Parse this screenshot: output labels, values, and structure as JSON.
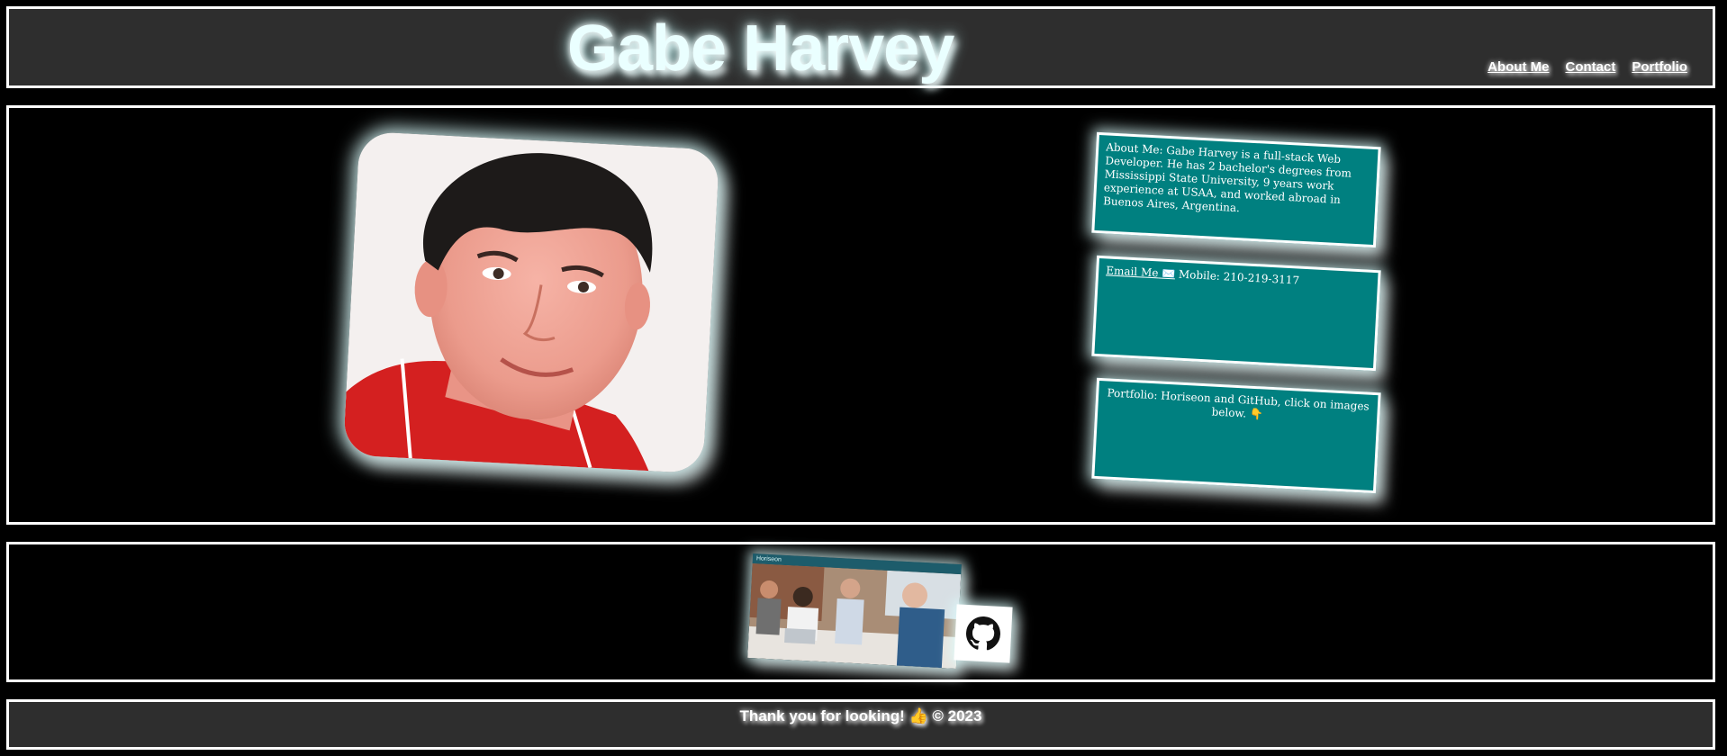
{
  "header": {
    "title": "Gabe Harvey",
    "nav": [
      "About Me",
      "Contact",
      "Portfolio"
    ]
  },
  "main": {
    "portrait_alt": "headshot",
    "about": "About Me: Gabe Harvey is a full-stack Web Developer. He has 2 bachelor's degrees from Mississippi State University, 9 years work experience at USAA, and worked abroad in Buenos Aires, Argentina.",
    "contact": {
      "email_link": "Email Me",
      "email_icon": "✉️",
      "mobile": "Mobile: 210-219-3117"
    },
    "portfolio": "Portfolio: Horiseon and GitHub, click on images below. 👇"
  },
  "projects": {
    "horiseon_label": "Horiseon",
    "github_icon": "github-icon"
  },
  "footer": {
    "text": "Thank you for looking! 👍 © 2023"
  },
  "colors": {
    "panel": "#2e2e2e",
    "card": "#008080",
    "border": "#ffffff",
    "background": "#000000"
  }
}
